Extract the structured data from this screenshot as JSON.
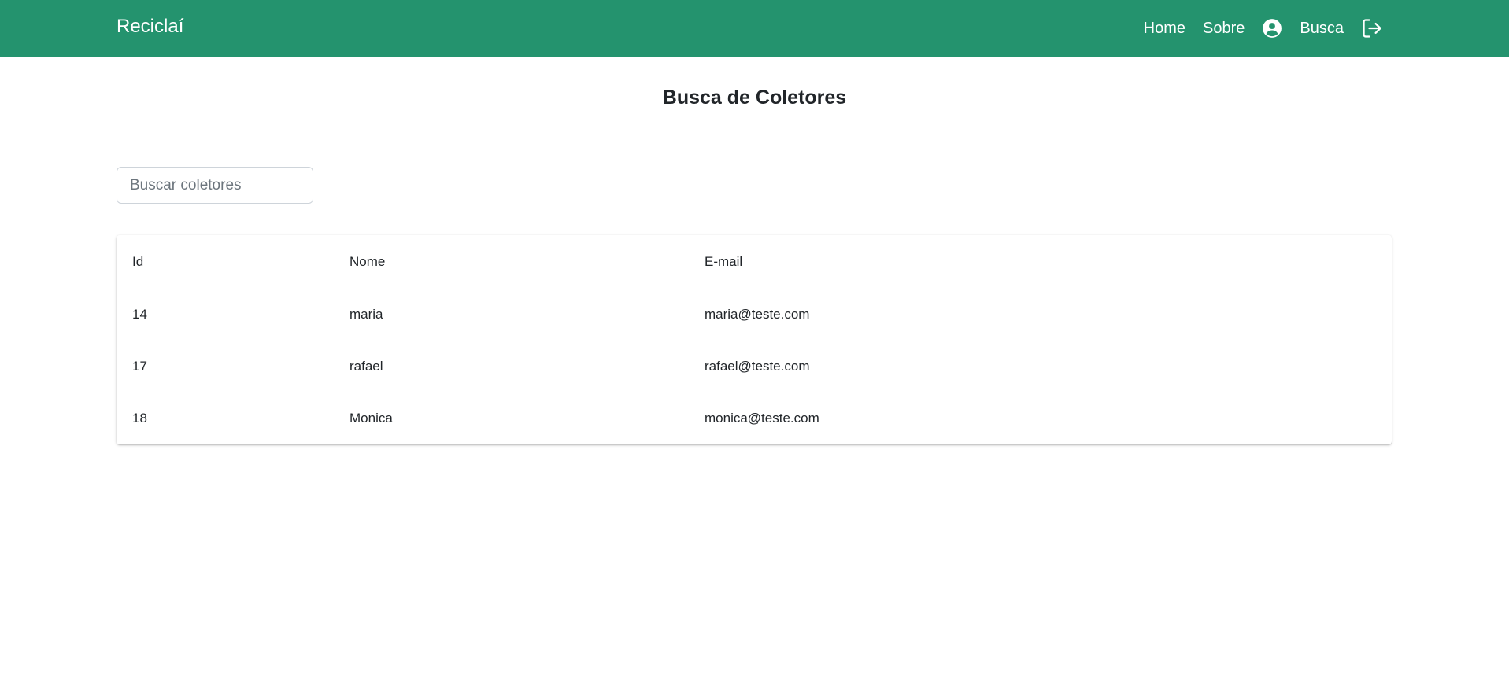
{
  "navbar": {
    "brand": "Reciclaí",
    "links": [
      {
        "label": "Home"
      },
      {
        "label": "Sobre"
      },
      {
        "label": "Busca"
      }
    ],
    "profile_icon": "user-circle-icon",
    "logout_icon": "logout-icon"
  },
  "page": {
    "title": "Busca de Coletores"
  },
  "search": {
    "placeholder": "Buscar coletores",
    "value": ""
  },
  "table": {
    "headers": [
      "Id",
      "Nome",
      "E-mail"
    ],
    "rows": [
      {
        "id": "14",
        "nome": "maria",
        "email": "maria@teste.com"
      },
      {
        "id": "17",
        "nome": "rafael",
        "email": "rafael@teste.com"
      },
      {
        "id": "18",
        "nome": "Monica",
        "email": "monica@teste.com"
      }
    ]
  },
  "colors": {
    "navbar": "#24936e",
    "text": "#212529"
  }
}
